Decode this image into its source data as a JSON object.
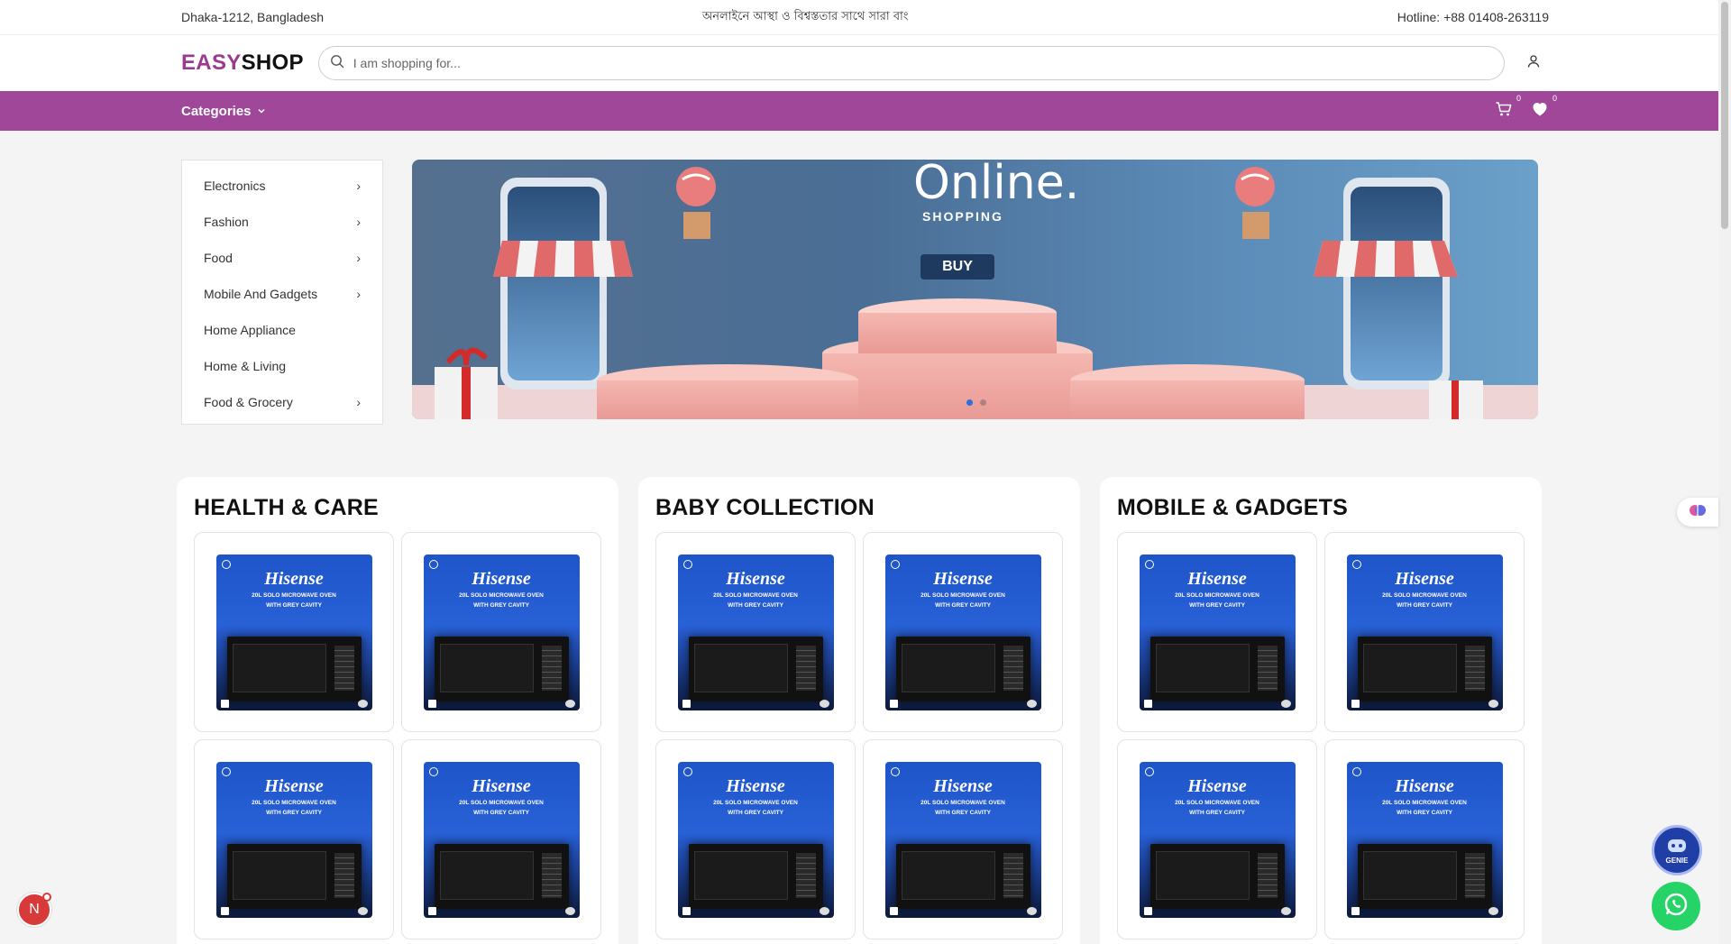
{
  "topbar": {
    "location": "Dhaka-1212, Bangladesh",
    "marquee": "অনলাইনে আস্থা ও বিশ্বস্ততার সাথে সারা বাং",
    "hotline": "Hotline: +88 01408-263119"
  },
  "header": {
    "logo_part1": "EASY",
    "logo_part2": "SHOP",
    "search_placeholder": "I am shopping for..."
  },
  "nav": {
    "categories_label": "Categories",
    "cart_count": "0",
    "wishlist_count": "0"
  },
  "sidebar": {
    "items": [
      {
        "label": "Electronics",
        "has_sub": true
      },
      {
        "label": "Fashion",
        "has_sub": true
      },
      {
        "label": "Food",
        "has_sub": true
      },
      {
        "label": "Mobile And Gadgets",
        "has_sub": true
      },
      {
        "label": "Home Appliance",
        "has_sub": false
      },
      {
        "label": "Home & Living",
        "has_sub": false
      },
      {
        "label": "Food & Grocery",
        "has_sub": true
      }
    ]
  },
  "banner": {
    "headline": "Online.",
    "sub": "SHOPPING",
    "cta": "BUY",
    "slides": 2,
    "active_slide": 1
  },
  "sections": [
    {
      "title": "HEALTH & CARE"
    },
    {
      "title": "BABY COLLECTION"
    },
    {
      "title": "MOBILE & GADGETS"
    }
  ],
  "product": {
    "brand": "Hisense",
    "line1": "20L SOLO MICROWAVE OVEN",
    "line2": "WITH GREY CAVITY"
  },
  "floating": {
    "notification_initial": "N",
    "genie_label": "GENIE"
  },
  "colors": {
    "brand_purple": "#a0479a",
    "logo_purple": "#9b3a8f",
    "product_blue": "#2860d6",
    "whatsapp": "#25d366"
  }
}
